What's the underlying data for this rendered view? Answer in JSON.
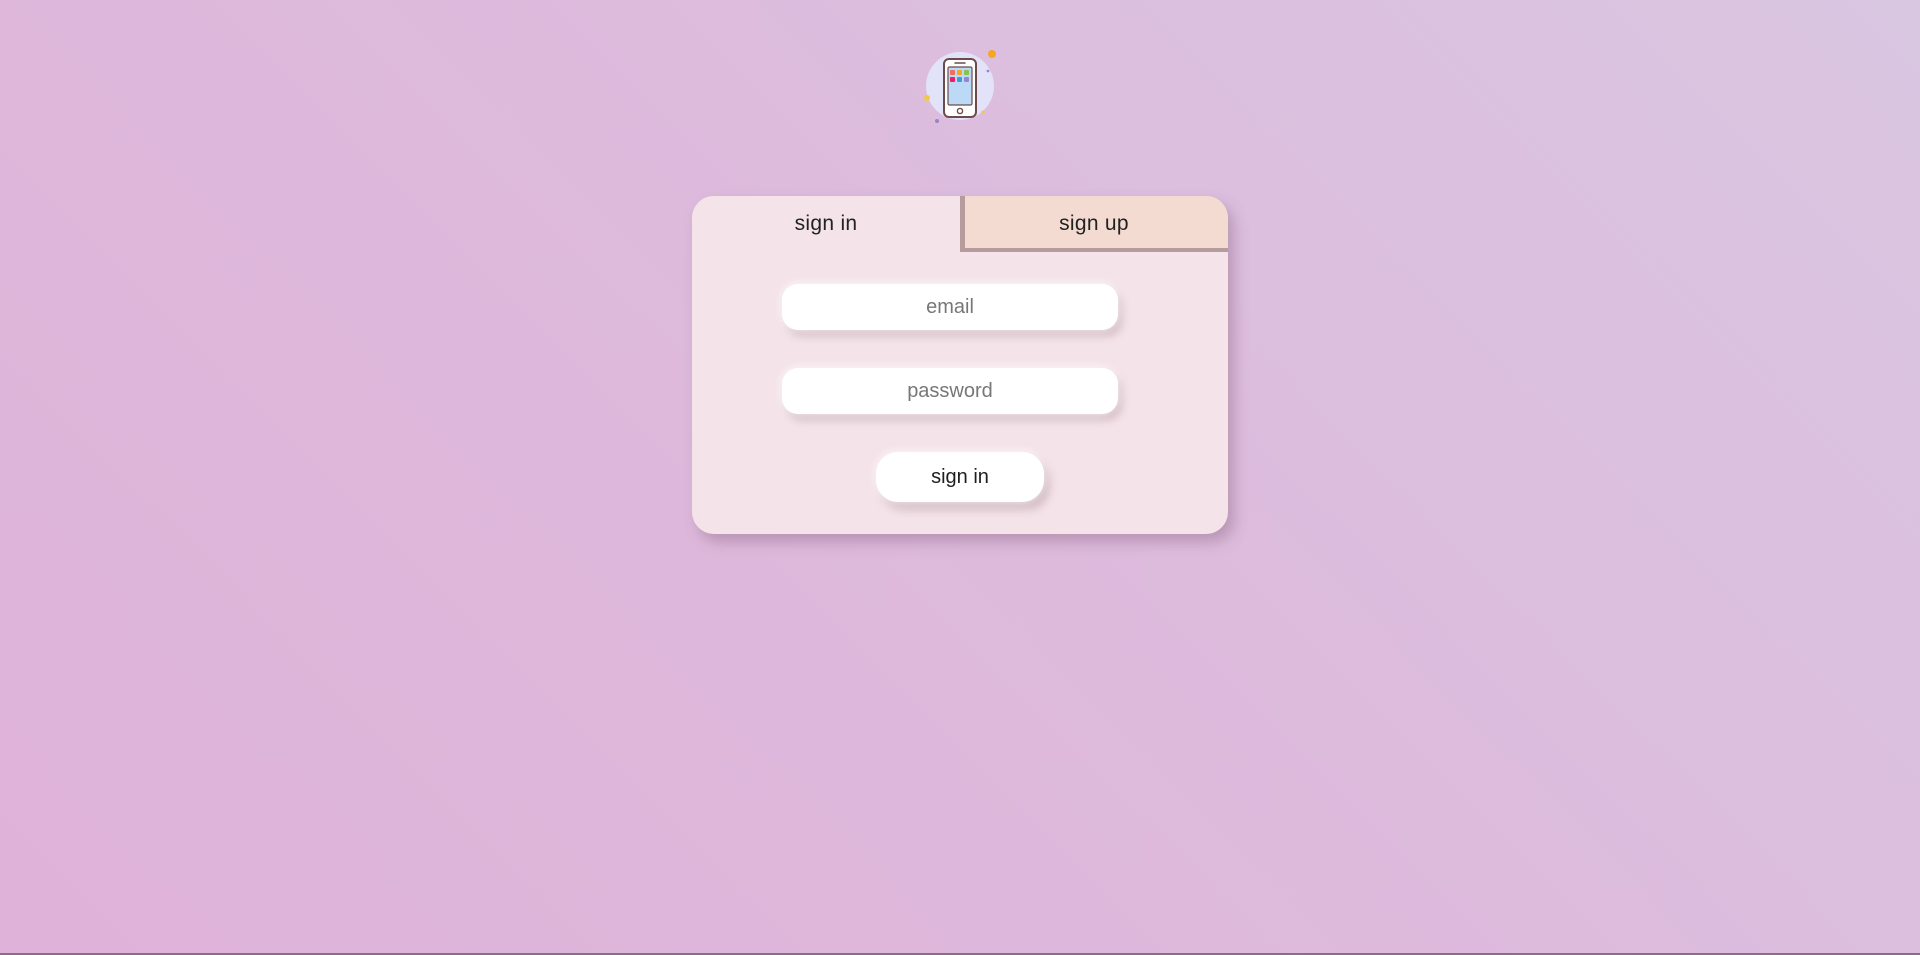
{
  "logo": {
    "icon": "smartphone-icon",
    "colors": {
      "circle": "#e2e2f8",
      "screen": "#bcdaf6",
      "outline": "#6d4b4b",
      "dot_orange": "#f5a623",
      "dot_yellow": "#f3c84a",
      "dot_purple": "#9b85c9"
    }
  },
  "auth": {
    "tabs": [
      {
        "label": "sign in",
        "active": true
      },
      {
        "label": "sign up",
        "active": false
      }
    ],
    "email_placeholder": "email",
    "password_placeholder": "password",
    "submit_label": "sign in"
  },
  "colors": {
    "background_start": "#d9c6e1",
    "background_end": "#dfb2d9",
    "card": "#f4e3e9",
    "inactive_tab": "#f4dbd1"
  }
}
